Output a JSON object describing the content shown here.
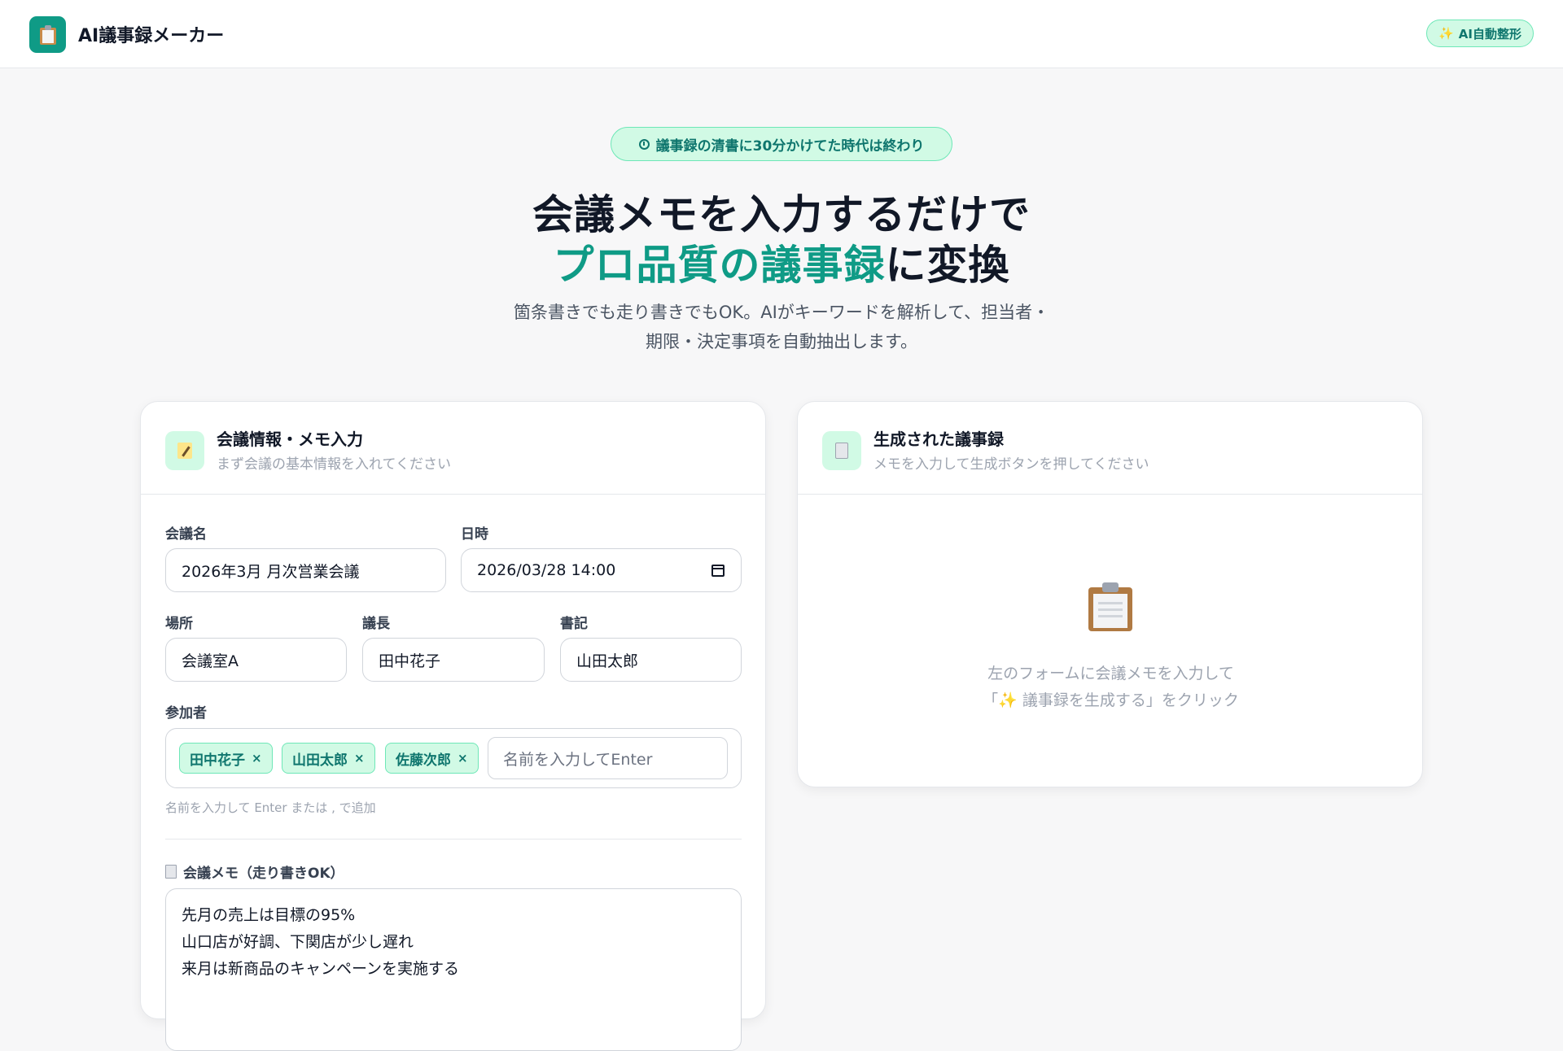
{
  "header": {
    "app_title": "AI議事録メーカー",
    "ai_badge": "AI自動整形"
  },
  "hero": {
    "pill": "議事録の清書に30分かけてた時代は終わり",
    "line1": "会議メモを入力するだけで",
    "line2_accent": "プロ品質の議事録",
    "line2_rest": "に変換",
    "sub1": "箇条書きでも走り書きでもOK。AIがキーワードを解析して、担当者・",
    "sub2": "期限・決定事項を自動抽出します。"
  },
  "input_card": {
    "title": "会議情報・メモ入力",
    "subtitle": "まず会議の基本情報を入れてください",
    "meeting_name_label": "会議名",
    "meeting_name_value": "2026年3月 月次営業会議",
    "datetime_label": "日時",
    "datetime_value": "2026/03/28 14:00",
    "location_label": "場所",
    "location_value": "会議室A",
    "chair_label": "議長",
    "chair_value": "田中花子",
    "secretary_label": "書記",
    "secretary_value": "山田太郎",
    "participants_label": "参加者",
    "participants": [
      "田中花子",
      "山田太郎",
      "佐藤次郎"
    ],
    "participant_remove": "×",
    "participant_placeholder": "名前を入力してEnter",
    "participant_hint": "名前を入力して Enter または , で追加",
    "memo_label": "会議メモ（走り書きOK）",
    "memo_lines": [
      "先月の売上は目標の95%",
      "山口店が好調、下関店が少し遅れ",
      "来月は新商品のキャンペーンを実施する"
    ]
  },
  "output_card": {
    "title": "生成された議事録",
    "subtitle": "メモを入力して生成ボタンを押してください",
    "empty_line1": "左のフォームに会議メモを入力して",
    "empty_line2": "「✨ 議事録を生成する」をクリック"
  },
  "colors": {
    "accent": "#0f9b86",
    "accent_light": "#d1fae5",
    "accent_dark": "#0f766e"
  }
}
